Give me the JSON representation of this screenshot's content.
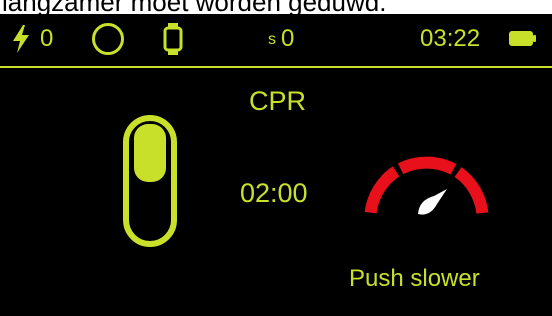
{
  "caption": {
    "text": "langzamer moet worden geduwd."
  },
  "status": {
    "shock_count": "0",
    "s_label": "s",
    "s_value": "0",
    "time": "03:22",
    "battery_level": 1.0,
    "icons": [
      "lightning-icon",
      "circle-icon",
      "watch-icon",
      "battery-icon"
    ]
  },
  "main": {
    "mode": "CPR",
    "timer": "02:00",
    "advice": "Push slower",
    "depth_slider_level": 0.7,
    "rate_gauge_position": "too-fast"
  },
  "colors": {
    "accent": "#c9e02a",
    "background": "#000000",
    "warning": "#e8101a",
    "needle": "#ffffff"
  }
}
